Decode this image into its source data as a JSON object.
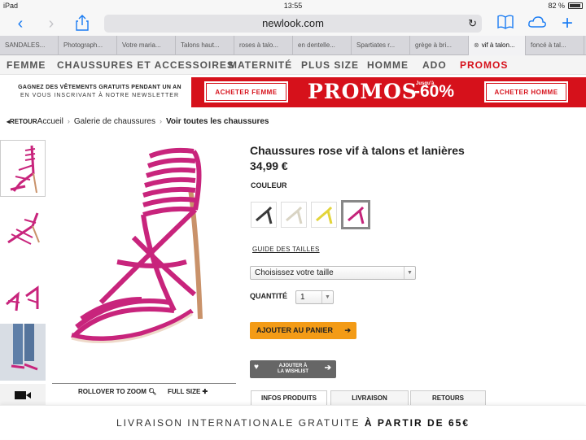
{
  "status": {
    "device": "iPad",
    "time": "13:55",
    "battery": "82 %"
  },
  "browser": {
    "url": "newlook.com",
    "tabs": [
      {
        "label": "SANDALES..."
      },
      {
        "label": "Photograph..."
      },
      {
        "label": "Votre maria..."
      },
      {
        "label": "Talons haut..."
      },
      {
        "label": "roses à talo..."
      },
      {
        "label": "en dentelle..."
      },
      {
        "label": "Spartiates r..."
      },
      {
        "label": "grège à bri..."
      },
      {
        "label": "vif à talon..."
      },
      {
        "label": "foncé à tal..."
      }
    ]
  },
  "nav": [
    "FEMME",
    "CHAUSSURES ET ACCESSOIRES",
    "MATERNITÉ",
    "PLUS SIZE",
    "HOMME",
    "ADO",
    "PROMOS"
  ],
  "banner": {
    "newsletter_line1": "GAGNEZ DES VÊTEMENTS GRATUITS PENDANT UN AN",
    "newsletter_line2": "EN VOUS INSCRIVANT À NOTRE NEWSLETTER",
    "btn_women": "ACHETER FEMME",
    "title": "PROMOS",
    "upto": "Jusqu'à",
    "percent": "-60%",
    "btn_men": "ACHETER HOMME"
  },
  "breadcrumb": {
    "back": "◂RETOUR",
    "home": "Accueil",
    "gallery": "Galerie de chaussures",
    "current": "Voir toutes les chaussures",
    "sep": "›"
  },
  "product": {
    "title": "Chaussures rose vif à talons et lanières",
    "price": "34,99 €",
    "color_label": "COULEUR",
    "size_guide": "GUIDE DES TAILLES",
    "size_placeholder": "Choisissez votre taille",
    "qty_label": "QUANTITÉ",
    "qty_value": "1",
    "add_to_cart": "AJOUTER AU PANIER",
    "wishlist_line1": "AJOUTER À",
    "wishlist_line2": "LA WISHLIST",
    "tabs": [
      "INFOS PRODUITS",
      "LIVRAISON",
      "RETOURS"
    ],
    "rollover": "ROLLOVER TO ZOOM",
    "fullsize": "FULL SIZE",
    "swatch_colors": [
      "#3a3a3a",
      "#f2efe4",
      "#e3d43a",
      "#c4247a"
    ]
  },
  "footer": {
    "text": "LIVRAISON INTERNATIONALE GRATUITE",
    "bold": "À PARTIR DE 65€"
  },
  "colors": {
    "accent": "#d6111b",
    "ios_blue": "#1a7cf3",
    "cta": "#f39b16",
    "shoe": "#c8247c"
  }
}
